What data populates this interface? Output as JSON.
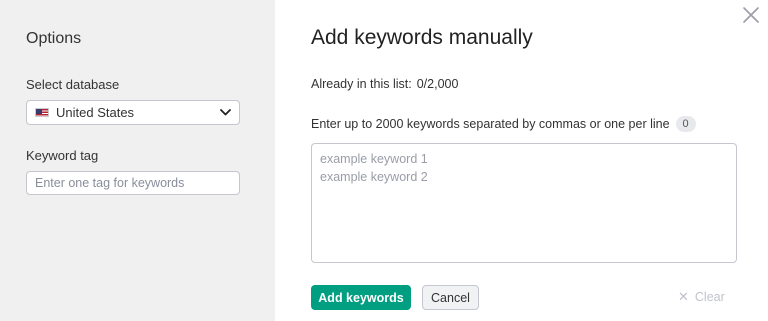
{
  "sidebar": {
    "title": "Options",
    "database_label": "Select database",
    "database_value": "United States",
    "database_flag": "us-flag-icon",
    "tag_label": "Keyword tag",
    "tag_placeholder": "Enter one tag for keywords"
  },
  "main": {
    "title": "Add keywords manually",
    "already_label": "Already in this list:",
    "already_count": "0/2,000",
    "instructions": "Enter up to 2000 keywords separated by commas or one per line",
    "keyword_count_badge": "0",
    "textarea_placeholder": "example keyword 1\nexample keyword 2"
  },
  "buttons": {
    "add": "Add keywords",
    "cancel": "Cancel",
    "clear": "Clear"
  },
  "colors": {
    "primary": "#009f81",
    "sidebar_bg": "#f0f0f1",
    "border": "#c4c7cf"
  }
}
